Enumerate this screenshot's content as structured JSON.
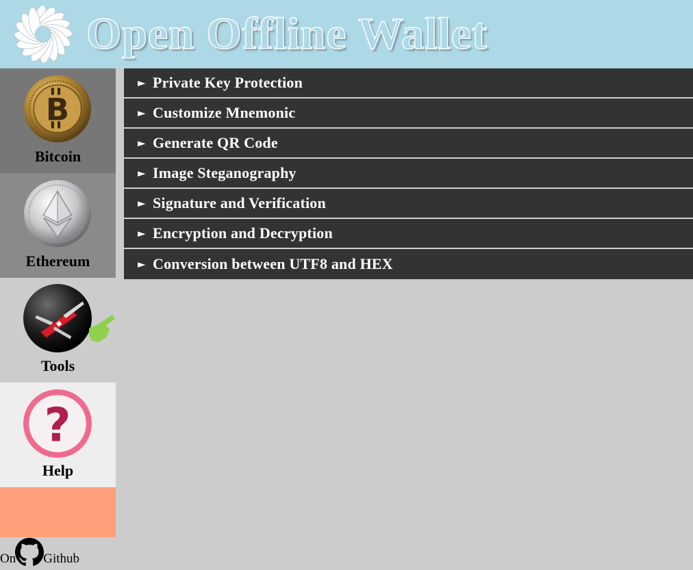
{
  "header": {
    "title": "Open Offline Wallet",
    "logo_icon": "flower-logo-icon",
    "background": "#add8e6"
  },
  "sidebar": {
    "items": [
      {
        "label": "Bitcoin",
        "icon": "bitcoin-coin-icon",
        "background": "#777777"
      },
      {
        "label": "Ethereum",
        "icon": "ethereum-coin-icon",
        "background": "#8a8a8a"
      },
      {
        "label": "Tools",
        "icon": "swiss-knife-icon",
        "background": "#cccccc",
        "selected": true
      },
      {
        "label": "Help",
        "icon": "question-mark-icon",
        "background": "#eeeeee"
      }
    ],
    "accent_block_color": "#ffa07a"
  },
  "github": {
    "prefix": "On",
    "suffix": "Github",
    "icon": "github-icon"
  },
  "tools": {
    "arrow": "►",
    "items": [
      {
        "label": "Private Key Protection"
      },
      {
        "label": "Customize Mnemonic"
      },
      {
        "label": "Generate QR Code"
      },
      {
        "label": "Image Steganography"
      },
      {
        "label": "Signature and Verification"
      },
      {
        "label": "Encryption and Decryption"
      },
      {
        "label": "Conversion between UTF8 and HEX"
      }
    ]
  }
}
